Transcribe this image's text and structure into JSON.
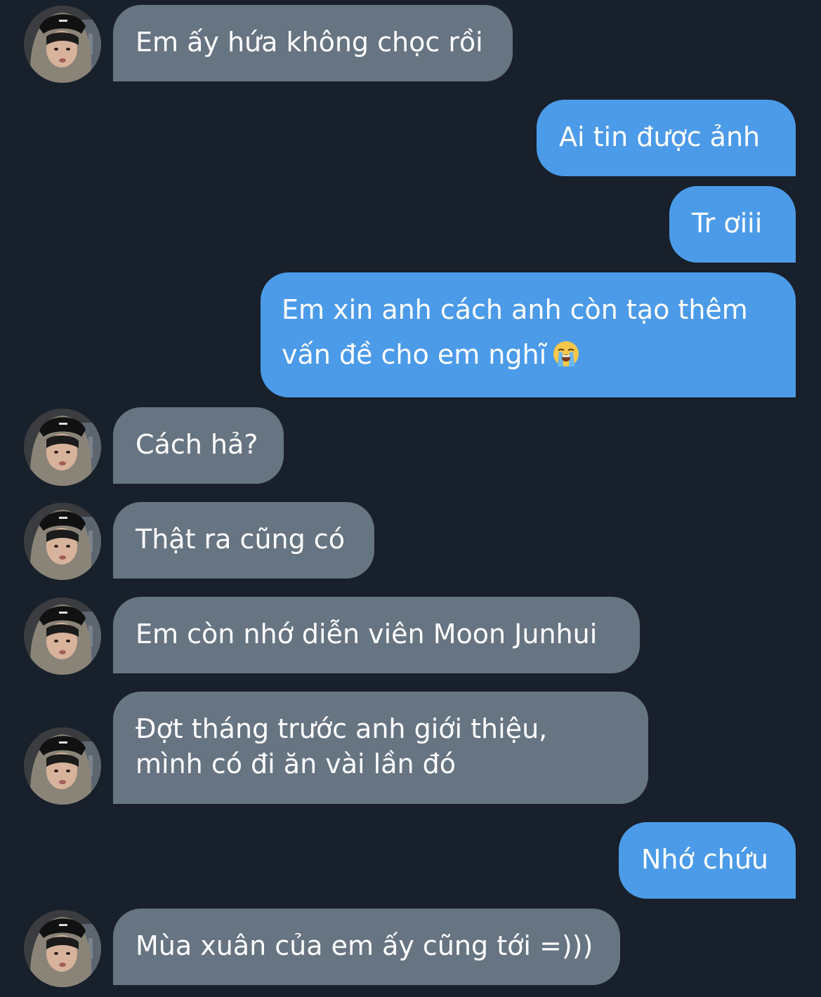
{
  "conversation": {
    "messages": [
      {
        "side": "received",
        "text": "Em ấy hứa không chọc rồi"
      },
      {
        "side": "sent",
        "text": "Ai tin được ảnh"
      },
      {
        "side": "sent",
        "text": "Tr ơiii"
      },
      {
        "side": "sent",
        "lines": [
          "Em xin anh cách anh còn tạo thêm",
          "vấn đề cho em nghĩ"
        ],
        "emoji": "loudly-crying-face-icon"
      },
      {
        "side": "received",
        "text": "Cách hả?"
      },
      {
        "side": "received",
        "text": "Thật ra cũng có"
      },
      {
        "side": "received",
        "text": "Em còn nhớ diễn viên Moon Junhui"
      },
      {
        "side": "received",
        "lines": [
          "Đợt tháng trước anh giới thiệu,",
          "mình có đi ăn vài lần đó"
        ]
      },
      {
        "side": "sent",
        "text": "Nhớ chứu"
      },
      {
        "side": "received",
        "text": "Mùa xuân của em ấy cũng tới =)))"
      }
    ]
  },
  "colors": {
    "background": "#18202b",
    "received_bubble": "#677482",
    "sent_bubble": "#4c9be8",
    "text": "#ffffff"
  },
  "avatar": {
    "icon": "profile-avatar"
  }
}
